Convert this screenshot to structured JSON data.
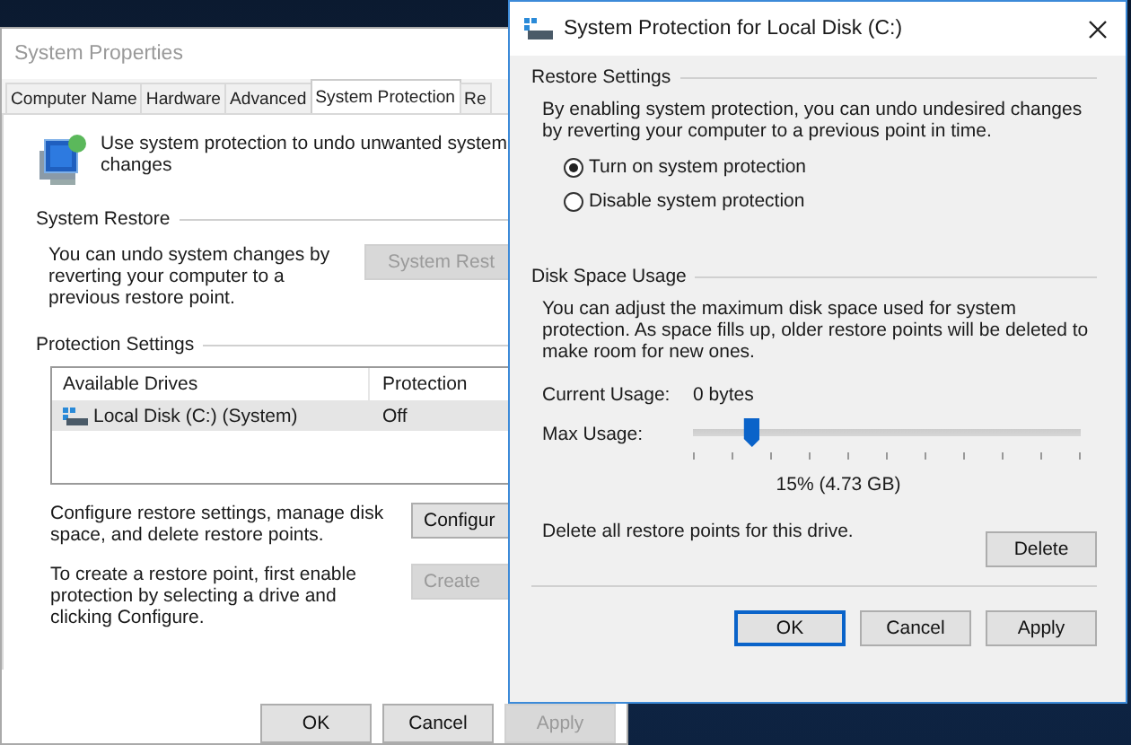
{
  "back_window": {
    "title": "System Properties",
    "tabs": [
      {
        "label": "Computer Name",
        "selected": false
      },
      {
        "label": "Hardware",
        "selected": false
      },
      {
        "label": "Advanced",
        "selected": false
      },
      {
        "label": "System Protection",
        "selected": true
      },
      {
        "label": "Re",
        "selected": false
      }
    ],
    "intro": "Use system protection to undo unwanted system changes",
    "system_restore": {
      "heading": "System Restore",
      "text": "You can undo system changes by reverting your computer to a previous restore point.",
      "button": {
        "label": "System Rest",
        "disabled": true
      }
    },
    "protection_settings": {
      "heading": "Protection Settings",
      "columns": [
        "Available Drives",
        "Protection"
      ],
      "rows": [
        {
          "drive": "Local Disk (C:) (System)",
          "protection": "Off",
          "selected": true
        }
      ],
      "configure": {
        "text": "Configure restore settings, manage disk space, and delete restore points.",
        "button": {
          "label": "Configur",
          "disabled": false
        }
      },
      "create": {
        "text": "To create a restore point, first enable protection by selecting a drive and clicking Configure.",
        "button": {
          "label": "Create",
          "disabled": true
        }
      }
    },
    "buttons": [
      {
        "label": "OK",
        "disabled": false
      },
      {
        "label": "Cancel",
        "disabled": false
      },
      {
        "label": "Apply",
        "disabled": true
      }
    ]
  },
  "front_window": {
    "title": "System Protection for Local Disk (C:)",
    "restore_settings": {
      "heading": "Restore Settings",
      "text": "By enabling system protection, you can undo undesired changes by reverting your computer to a previous point in time.",
      "options": [
        {
          "label": "Turn on system protection",
          "selected": true
        },
        {
          "label": "Disable system protection",
          "selected": false
        }
      ]
    },
    "disk_space": {
      "heading": "Disk Space Usage",
      "text": "You can adjust the maximum disk space used for system protection. As space fills up, older restore points will be deleted to make room for new ones.",
      "current_usage_label": "Current Usage:",
      "current_usage": "0 bytes",
      "max_usage_label": "Max Usage:",
      "max_usage": {
        "level": 0.15
      },
      "reading": "15% (4.73 GB)",
      "delete_text": "Delete all restore points for this drive.",
      "delete_button": "Delete"
    },
    "buttons": [
      {
        "label": "OK",
        "default": true
      },
      {
        "label": "Cancel",
        "default": false
      },
      {
        "label": "Apply",
        "default": false
      }
    ]
  }
}
